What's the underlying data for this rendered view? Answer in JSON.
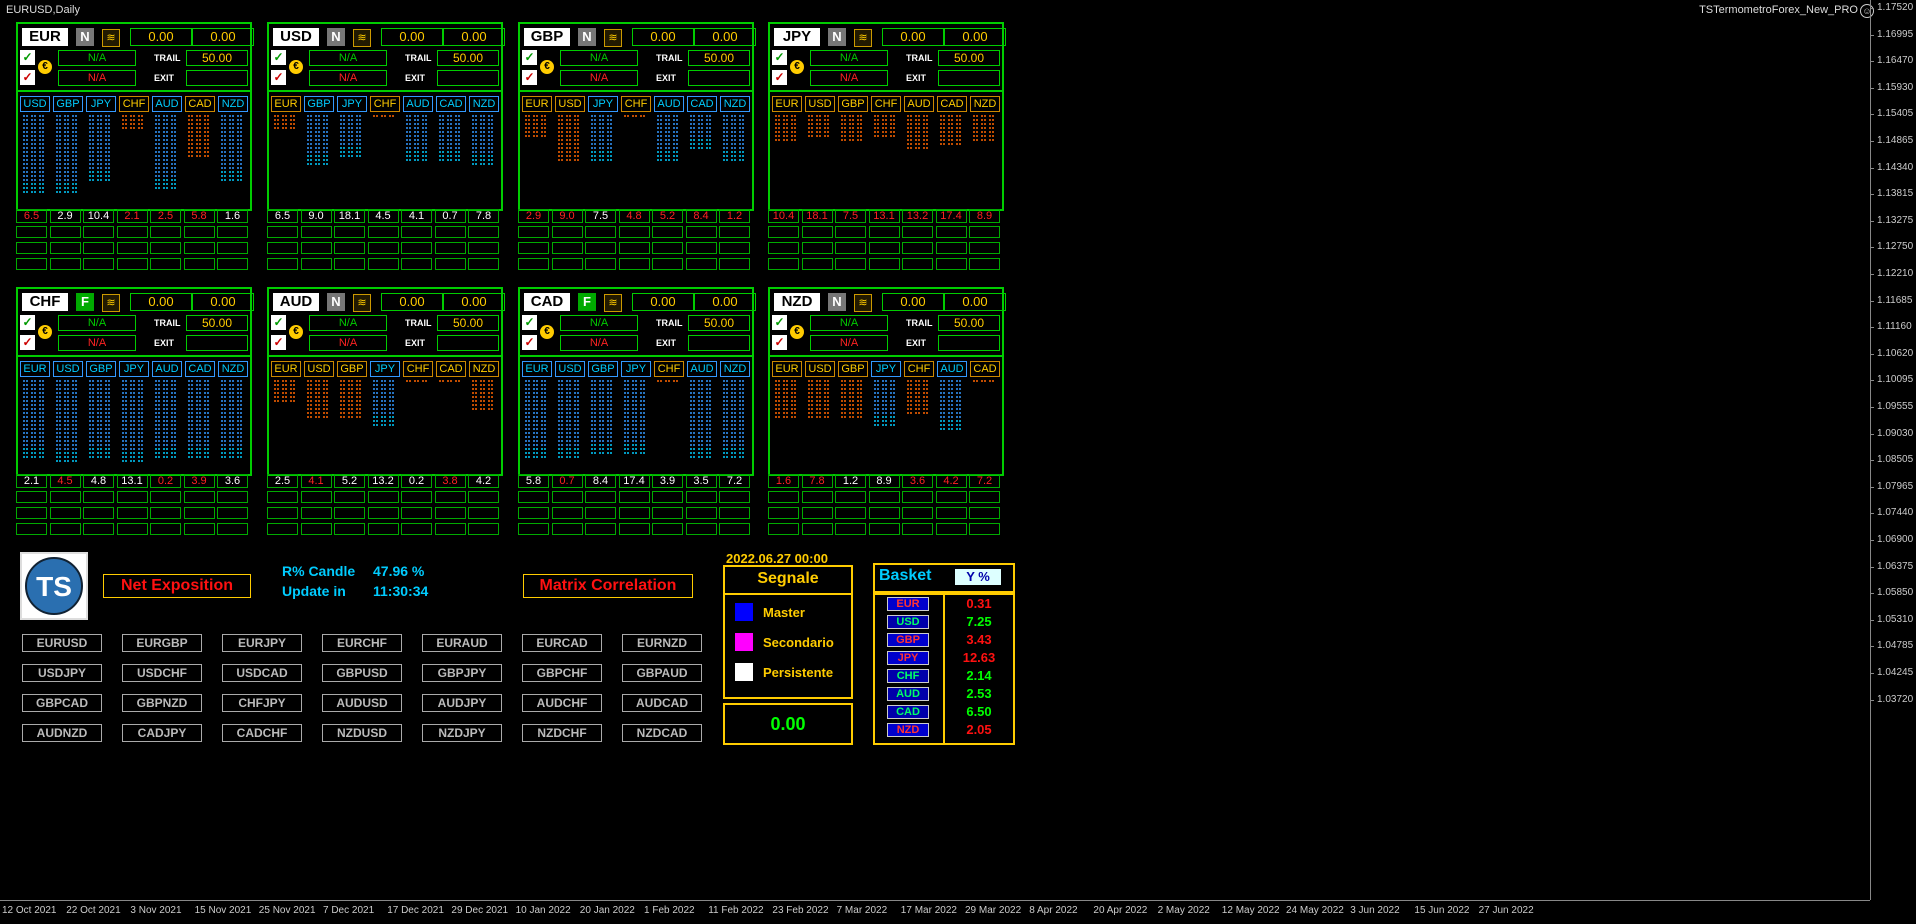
{
  "chart": {
    "symbol": "EURUSD,Daily",
    "indicator": "TSTermometroForex_New_PRO",
    "smiley": "☺"
  },
  "price_axis": [
    "1.17520",
    "1.16995",
    "1.16470",
    "1.15930",
    "1.15405",
    "1.14865",
    "1.14340",
    "1.13815",
    "1.13275",
    "1.12750",
    "1.12210",
    "1.11685",
    "1.11160",
    "1.10620",
    "1.10095",
    "1.09555",
    "1.09030",
    "1.08505",
    "1.07965",
    "1.07440",
    "1.06900",
    "1.06375",
    "1.05850",
    "1.05310",
    "1.04785",
    "1.04245",
    "1.03720"
  ],
  "time_axis": [
    "12 Oct 2021",
    "22 Oct 2021",
    "3 Nov 2021",
    "15 Nov 2021",
    "25 Nov 2021",
    "7 Dec 2021",
    "17 Dec 2021",
    "29 Dec 2021",
    "10 Jan 2022",
    "20 Jan 2022",
    "1 Feb 2022",
    "11 Feb 2022",
    "23 Feb 2022",
    "7 Mar 2022",
    "17 Mar 2022",
    "29 Mar 2022",
    "8 Apr 2022",
    "20 Apr 2022",
    "2 May 2022",
    "12 May 2022",
    "24 May 2022",
    "3 Jun 2022",
    "15 Jun 2022",
    "27 Jun 2022"
  ],
  "labels": {
    "trail": "TRAIL",
    "exit": "EXIT",
    "na": "N/A",
    "trail_value": "50.00",
    "zero": "0.00",
    "check": "✓",
    "euro": "€",
    "wave": "≋"
  },
  "colors": {
    "green": "#00cc00",
    "red": "#ff2222",
    "blue": "#3399ff",
    "orange": "#ff6600",
    "cyan": "#00ccff",
    "yellow": "#ffcc00"
  },
  "panels": [
    {
      "name": "EUR",
      "flag": "N",
      "v1": "0.00",
      "v2": "0.00",
      "tabs": [
        "USD",
        "GBP",
        "JPY",
        "CHF",
        "AUD",
        "CAD",
        "NZD"
      ],
      "bars": [
        {
          "dir": "up",
          "level": 0.9
        },
        {
          "dir": "up",
          "level": 0.9
        },
        {
          "dir": "up",
          "level": 0.75
        },
        {
          "dir": "down",
          "level": 0.2
        },
        {
          "dir": "up",
          "level": 0.85
        },
        {
          "dir": "down",
          "level": 0.5
        },
        {
          "dir": "up",
          "level": 0.75
        }
      ],
      "nums": [
        {
          "v": "6.5",
          "c": "red"
        },
        {
          "v": "2.9",
          "c": "white"
        },
        {
          "v": "10.4",
          "c": "white"
        },
        {
          "v": "2.1",
          "c": "red"
        },
        {
          "v": "2.5",
          "c": "red"
        },
        {
          "v": "5.8",
          "c": "red"
        },
        {
          "v": "1.6",
          "c": "white"
        }
      ]
    },
    {
      "name": "USD",
      "flag": "N",
      "v1": "0.00",
      "v2": "0.00",
      "tabs": [
        "EUR",
        "GBP",
        "JPY",
        "CHF",
        "AUD",
        "CAD",
        "NZD"
      ],
      "bars": [
        {
          "dir": "down",
          "level": 0.2
        },
        {
          "dir": "up",
          "level": 0.6
        },
        {
          "dir": "up",
          "level": 0.5
        },
        {
          "dir": "down",
          "level": 0.05
        },
        {
          "dir": "up",
          "level": 0.55
        },
        {
          "dir": "up",
          "level": 0.55
        },
        {
          "dir": "up",
          "level": 0.6
        }
      ],
      "nums": [
        {
          "v": "6.5",
          "c": "white"
        },
        {
          "v": "9.0",
          "c": "white"
        },
        {
          "v": "18.1",
          "c": "white"
        },
        {
          "v": "4.5",
          "c": "white"
        },
        {
          "v": "4.1",
          "c": "white"
        },
        {
          "v": "0.7",
          "c": "white"
        },
        {
          "v": "7.8",
          "c": "white"
        }
      ]
    },
    {
      "name": "GBP",
      "flag": "N",
      "v1": "0.00",
      "v2": "0.00",
      "tabs": [
        "EUR",
        "USD",
        "JPY",
        "CHF",
        "AUD",
        "CAD",
        "NZD"
      ],
      "bars": [
        {
          "dir": "down",
          "level": 0.25
        },
        {
          "dir": "down",
          "level": 0.55
        },
        {
          "dir": "up",
          "level": 0.55
        },
        {
          "dir": "down",
          "level": 0.05
        },
        {
          "dir": "up",
          "level": 0.55
        },
        {
          "dir": "up",
          "level": 0.4
        },
        {
          "dir": "up",
          "level": 0.55
        }
      ],
      "nums": [
        {
          "v": "2.9",
          "c": "red"
        },
        {
          "v": "9.0",
          "c": "red"
        },
        {
          "v": "7.5",
          "c": "white"
        },
        {
          "v": "4.8",
          "c": "red"
        },
        {
          "v": "5.2",
          "c": "red"
        },
        {
          "v": "8.4",
          "c": "red"
        },
        {
          "v": "1.2",
          "c": "red"
        }
      ]
    },
    {
      "name": "JPY",
      "flag": "N",
      "v1": "0.00",
      "v2": "0.00",
      "tabs": [
        "EUR",
        "USD",
        "GBP",
        "CHF",
        "AUD",
        "CAD",
        "NZD"
      ],
      "bars": [
        {
          "dir": "down",
          "level": 0.3
        },
        {
          "dir": "down",
          "level": 0.25
        },
        {
          "dir": "down",
          "level": 0.3
        },
        {
          "dir": "down",
          "level": 0.25
        },
        {
          "dir": "down",
          "level": 0.4
        },
        {
          "dir": "down",
          "level": 0.35
        },
        {
          "dir": "down",
          "level": 0.3
        }
      ],
      "nums": [
        {
          "v": "10.4",
          "c": "red"
        },
        {
          "v": "18.1",
          "c": "red"
        },
        {
          "v": "7.5",
          "c": "red"
        },
        {
          "v": "13.1",
          "c": "red"
        },
        {
          "v": "13.2",
          "c": "red"
        },
        {
          "v": "17.4",
          "c": "red"
        },
        {
          "v": "8.9",
          "c": "red"
        }
      ]
    },
    {
      "name": "CHF",
      "flag": "F",
      "v1": "0.00",
      "v2": "0.00",
      "tabs": [
        "EUR",
        "USD",
        "GBP",
        "JPY",
        "AUD",
        "CAD",
        "NZD"
      ],
      "bars": [
        {
          "dir": "up",
          "level": 0.9
        },
        {
          "dir": "up",
          "level": 0.95
        },
        {
          "dir": "up",
          "level": 0.9
        },
        {
          "dir": "up",
          "level": 0.95
        },
        {
          "dir": "up",
          "level": 0.9
        },
        {
          "dir": "up",
          "level": 0.9
        },
        {
          "dir": "up",
          "level": 0.9
        }
      ],
      "nums": [
        {
          "v": "2.1",
          "c": "white"
        },
        {
          "v": "4.5",
          "c": "red"
        },
        {
          "v": "4.8",
          "c": "white"
        },
        {
          "v": "13.1",
          "c": "white"
        },
        {
          "v": "0.2",
          "c": "red"
        },
        {
          "v": "3.9",
          "c": "red"
        },
        {
          "v": "3.6",
          "c": "white"
        }
      ]
    },
    {
      "name": "AUD",
      "flag": "N",
      "v1": "0.00",
      "v2": "0.00",
      "tabs": [
        "EUR",
        "USD",
        "GBP",
        "JPY",
        "CHF",
        "CAD",
        "NZD"
      ],
      "bars": [
        {
          "dir": "down",
          "level": 0.25
        },
        {
          "dir": "down",
          "level": 0.45
        },
        {
          "dir": "down",
          "level": 0.45
        },
        {
          "dir": "up",
          "level": 0.55
        },
        {
          "dir": "down",
          "level": 0.05
        },
        {
          "dir": "down",
          "level": 0.05
        },
        {
          "dir": "down",
          "level": 0.35
        }
      ],
      "nums": [
        {
          "v": "2.5",
          "c": "white"
        },
        {
          "v": "4.1",
          "c": "red"
        },
        {
          "v": "5.2",
          "c": "white"
        },
        {
          "v": "13.2",
          "c": "white"
        },
        {
          "v": "0.2",
          "c": "white"
        },
        {
          "v": "3.8",
          "c": "red"
        },
        {
          "v": "4.2",
          "c": "white"
        }
      ]
    },
    {
      "name": "CAD",
      "flag": "F",
      "v1": "0.00",
      "v2": "0.00",
      "tabs": [
        "EUR",
        "USD",
        "GBP",
        "JPY",
        "CHF",
        "AUD",
        "NZD"
      ],
      "bars": [
        {
          "dir": "up",
          "level": 0.9
        },
        {
          "dir": "up",
          "level": 0.9
        },
        {
          "dir": "up",
          "level": 0.85
        },
        {
          "dir": "up",
          "level": 0.85
        },
        {
          "dir": "down",
          "level": 0.05
        },
        {
          "dir": "up",
          "level": 0.9
        },
        {
          "dir": "up",
          "level": 0.9
        }
      ],
      "nums": [
        {
          "v": "5.8",
          "c": "white"
        },
        {
          "v": "0.7",
          "c": "red"
        },
        {
          "v": "8.4",
          "c": "white"
        },
        {
          "v": "17.4",
          "c": "white"
        },
        {
          "v": "3.9",
          "c": "white"
        },
        {
          "v": "3.5",
          "c": "white"
        },
        {
          "v": "7.2",
          "c": "white"
        }
      ]
    },
    {
      "name": "NZD",
      "flag": "N",
      "v1": "0.00",
      "v2": "0.00",
      "tabs": [
        "EUR",
        "USD",
        "GBP",
        "JPY",
        "CHF",
        "AUD",
        "CAD"
      ],
      "bars": [
        {
          "dir": "down",
          "level": 0.45
        },
        {
          "dir": "down",
          "level": 0.45
        },
        {
          "dir": "down",
          "level": 0.45
        },
        {
          "dir": "up",
          "level": 0.55
        },
        {
          "dir": "down",
          "level": 0.4
        },
        {
          "dir": "up",
          "level": 0.6
        },
        {
          "dir": "down",
          "level": 0.05
        }
      ],
      "nums": [
        {
          "v": "1.6",
          "c": "red"
        },
        {
          "v": "7.8",
          "c": "red"
        },
        {
          "v": "1.2",
          "c": "white"
        },
        {
          "v": "8.9",
          "c": "white"
        },
        {
          "v": "3.6",
          "c": "red"
        },
        {
          "v": "4.2",
          "c": "red"
        },
        {
          "v": "7.2",
          "c": "red"
        }
      ]
    }
  ],
  "net_exposition": "Net Exposition",
  "matrix_correlation": "Matrix Correlation",
  "r_candle": {
    "label": "R% Candle",
    "value": "47.96 %"
  },
  "update": {
    "label": "Update in",
    "value": "11:30:34"
  },
  "pairs": [
    [
      "EURUSD",
      "EURGBP",
      "EURJPY",
      "EURCHF",
      "EURAUD",
      "EURCAD",
      "EURNZD"
    ],
    [
      "USDJPY",
      "USDCHF",
      "USDCAD",
      "GBPUSD",
      "GBPJPY",
      "GBPCHF",
      "GBPAUD"
    ],
    [
      "GBPCAD",
      "GBPNZD",
      "CHFJPY",
      "AUDUSD",
      "AUDJPY",
      "AUDCHF",
      "AUDCAD"
    ],
    [
      "AUDNZD",
      "CADJPY",
      "CADCHF",
      "NZDUSD",
      "NZDJPY",
      "NZDCHF",
      "NZDCAD"
    ]
  ],
  "signal": {
    "date": "2022.06.27 00:00",
    "title": "Segnale",
    "items": [
      {
        "label": "Master",
        "color": "#0000ff"
      },
      {
        "label": "Secondario",
        "color": "#ff00ff"
      },
      {
        "label": "Persistente",
        "color": "#ffffff"
      }
    ],
    "value": "0.00"
  },
  "basket": {
    "title": "Basket",
    "mode": "Y %",
    "rows": [
      {
        "cur": "EUR",
        "value": "0.31",
        "neg": true
      },
      {
        "cur": "USD",
        "value": "7.25",
        "neg": false
      },
      {
        "cur": "GBP",
        "value": "3.43",
        "neg": true
      },
      {
        "cur": "JPY",
        "value": "12.63",
        "neg": true
      },
      {
        "cur": "CHF",
        "value": "2.14",
        "neg": false
      },
      {
        "cur": "AUD",
        "value": "2.53",
        "neg": false
      },
      {
        "cur": "CAD",
        "value": "6.50",
        "neg": false
      },
      {
        "cur": "NZD",
        "value": "2.05",
        "neg": true
      }
    ]
  }
}
